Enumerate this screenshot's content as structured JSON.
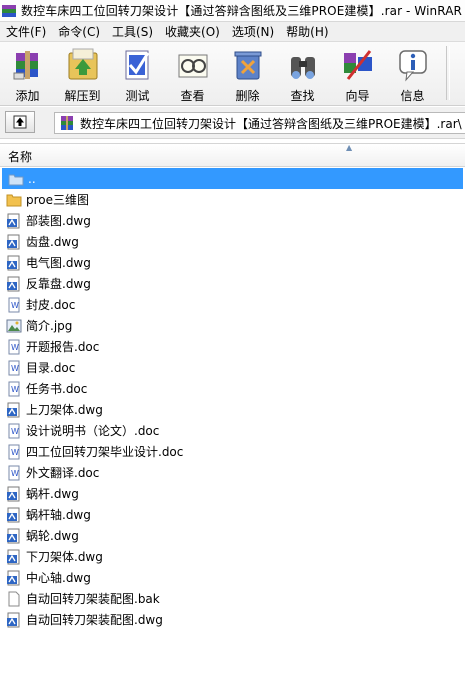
{
  "window": {
    "title": "数控车床四工位回转刀架设计【通过答辩含图纸及三维PROE建模】.rar - WinRAR"
  },
  "menu": [
    "文件(F)",
    "命令(C)",
    "工具(S)",
    "收藏夹(O)",
    "选项(N)",
    "帮助(H)"
  ],
  "toolbar": [
    {
      "label": "添加",
      "icon": "add-archive-icon"
    },
    {
      "label": "解压到",
      "icon": "extract-to-icon"
    },
    {
      "label": "测试",
      "icon": "test-icon"
    },
    {
      "label": "查看",
      "icon": "view-icon"
    },
    {
      "label": "删除",
      "icon": "delete-icon"
    },
    {
      "label": "查找",
      "icon": "find-icon"
    },
    {
      "label": "向导",
      "icon": "wizard-icon"
    },
    {
      "label": "信息",
      "icon": "info-icon"
    }
  ],
  "address": {
    "path": "数控车床四工位回转刀架设计【通过答辩含图纸及三维PROE建模】.rar\\"
  },
  "list": {
    "column_name": "名称",
    "items": [
      {
        "name": "..",
        "type": "up"
      },
      {
        "name": "proe三维图",
        "type": "folder"
      },
      {
        "name": "部装图.dwg",
        "type": "dwg"
      },
      {
        "name": "齿盘.dwg",
        "type": "dwg"
      },
      {
        "name": "电气图.dwg",
        "type": "dwg"
      },
      {
        "name": "反靠盘.dwg",
        "type": "dwg"
      },
      {
        "name": "封皮.doc",
        "type": "doc"
      },
      {
        "name": "简介.jpg",
        "type": "jpg"
      },
      {
        "name": "开题报告.doc",
        "type": "doc"
      },
      {
        "name": "目录.doc",
        "type": "doc"
      },
      {
        "name": "任务书.doc",
        "type": "doc"
      },
      {
        "name": "上刀架体.dwg",
        "type": "dwg"
      },
      {
        "name": "设计说明书（论文）.doc",
        "type": "doc"
      },
      {
        "name": "四工位回转刀架毕业设计.doc",
        "type": "doc"
      },
      {
        "name": "外文翻译.doc",
        "type": "doc"
      },
      {
        "name": "蜗杆.dwg",
        "type": "dwg"
      },
      {
        "name": "蜗杆轴.dwg",
        "type": "dwg"
      },
      {
        "name": "蜗轮.dwg",
        "type": "dwg"
      },
      {
        "name": "下刀架体.dwg",
        "type": "dwg"
      },
      {
        "name": "中心轴.dwg",
        "type": "dwg"
      },
      {
        "name": "自动回转刀架装配图.bak",
        "type": "bak"
      },
      {
        "name": "自动回转刀架装配图.dwg",
        "type": "dwg"
      }
    ]
  },
  "colors": {
    "selection": "#3399ff",
    "folder": "#f2c14e",
    "dwg": "#2e66c4"
  }
}
